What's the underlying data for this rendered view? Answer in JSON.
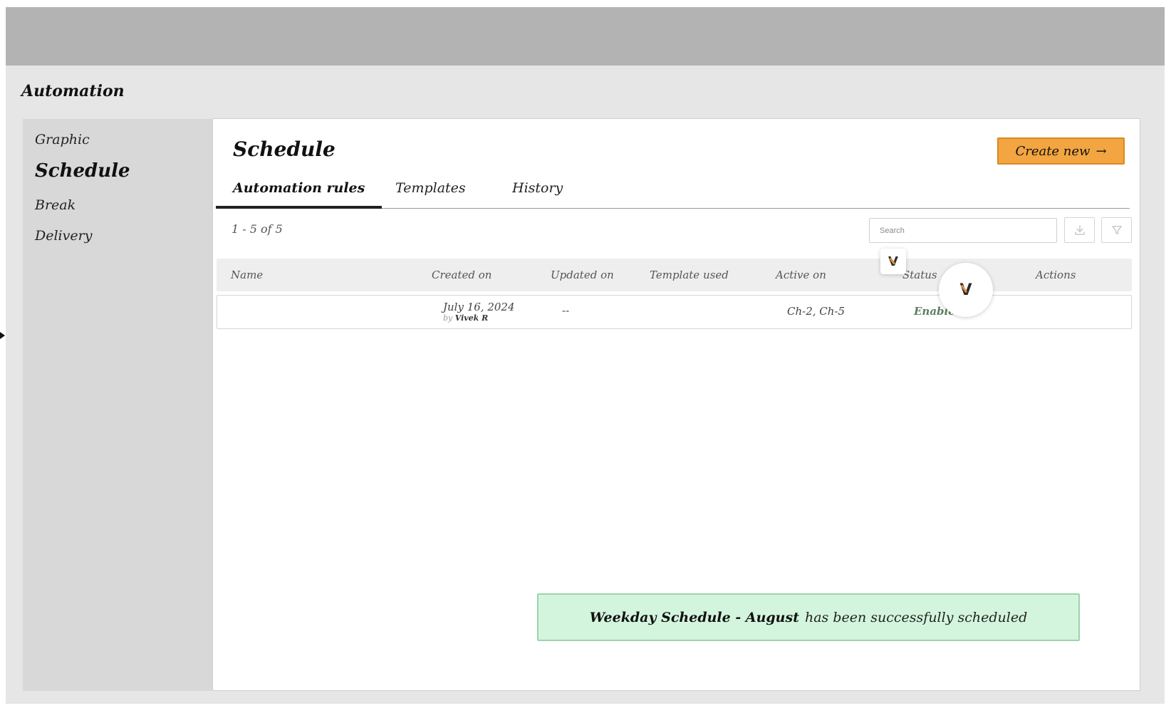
{
  "app": {
    "title": "Automation"
  },
  "sidebar": {
    "items": [
      {
        "label": "Graphic"
      },
      {
        "label": "Schedule",
        "active": true
      },
      {
        "label": "Break"
      },
      {
        "label": "Delivery"
      }
    ]
  },
  "main": {
    "title": "Schedule",
    "create_label": "Create new",
    "create_arrow": "→",
    "tabs": [
      {
        "label": "Automation rules",
        "active": true
      },
      {
        "label": "Templates"
      },
      {
        "label": "History"
      }
    ],
    "count": "1 - 5 of 5",
    "search": {
      "placeholder": "Search",
      "value": ""
    },
    "toolbar": {
      "download_icon": "download-icon",
      "filter_icon": "filter-icon"
    }
  },
  "table": {
    "columns": [
      "Name",
      "Created on",
      "Updated on",
      "Template used",
      "Active on",
      "Status",
      "Actions"
    ],
    "rows": [
      {
        "name": "",
        "created_date": "July 16, 2024",
        "created_by_label": "by",
        "created_by_name": "Vivek R",
        "updated": "--",
        "template": "",
        "active_on": "Ch-2, Ch-5",
        "status": "Enabled",
        "actions": ""
      }
    ]
  },
  "toast": {
    "strong": "Weekday Schedule - August",
    "rest": "has been successfully scheduled"
  },
  "colors": {
    "accent": "#f2a541",
    "toast_bg": "#d3f5dd",
    "status_enabled": "#5b7f5e"
  },
  "overlay": {
    "badge_glyph": "V"
  }
}
